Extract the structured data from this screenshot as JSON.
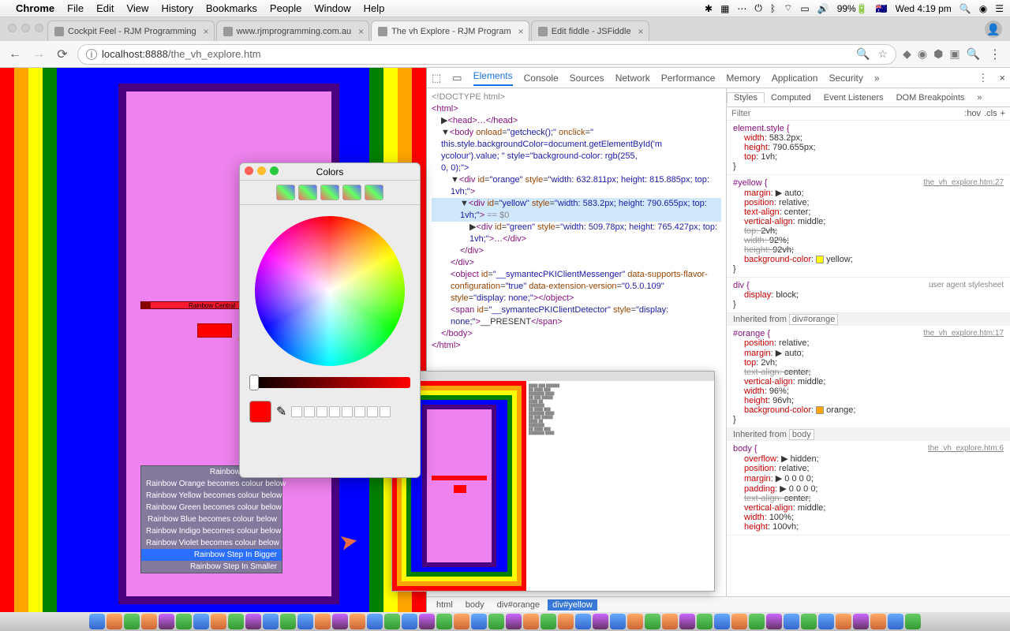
{
  "menubar": {
    "app": "Chrome",
    "items": [
      "File",
      "Edit",
      "View",
      "History",
      "Bookmarks",
      "People",
      "Window",
      "Help"
    ],
    "battery": "99%",
    "clock": "Wed 4:19 pm",
    "flag": "🇦🇺"
  },
  "tabs": [
    {
      "title": "Cockpit Feel - RJM Programming"
    },
    {
      "title": "www.rjmprogramming.com.au"
    },
    {
      "title": "The vh Explore - RJM Program",
      "active": true
    },
    {
      "title": "Edit fiddle - JSFiddle"
    }
  ],
  "omnibox": {
    "host": "localhost:8888",
    "path": "/the_vh_explore.htm"
  },
  "rainbow_label": "Rainbow Central",
  "dropdown": {
    "options": [
      "Rainbow Central",
      "Rainbow Orange becomes colour below",
      "Rainbow Yellow becomes colour below",
      "Rainbow Green becomes colour below",
      "Rainbow Blue becomes colour below",
      "Rainbow Indigo becomes colour below",
      "Rainbow Violet becomes colour below",
      "Rainbow Step In Bigger",
      "Rainbow Step In Smaller"
    ],
    "checked_index": 0,
    "selected_index": 7
  },
  "colorpicker": {
    "title": "Colors"
  },
  "devtools": {
    "tabs": [
      "Elements",
      "Console",
      "Sources",
      "Network",
      "Performance",
      "Memory",
      "Application",
      "Security"
    ],
    "active_tab": "Elements",
    "elements": {
      "doctype": "<!DOCTYPE html>",
      "html_open": "<html>",
      "head": "<head>…</head>",
      "body_open": "<body onload=\"getcheck();\" onclick=\"",
      "body_line2": "this.style.backgroundColor=document.getElementById('m",
      "body_line3": "ycolour').value; \" style=\"background-color: rgb(255,",
      "body_line4": "0, 0);\">",
      "orange": "<div id=\"orange\" style=\"width: 632.811px; height: 815.885px; top: 1vh;\">",
      "yellow": "<div id=\"yellow\" style=\"width: 583.2px; height: 790.655px; top: 1vh;\"> == $0",
      "green": "<div id=\"green\" style=\"width: 509.78px; height: 765.427px; top: 1vh;\">…</div>",
      "div_close": "</div>",
      "object": "<object id=\"__symantecPKIClientMessenger\" data-supports-flavor-configuration=\"true\" data-extension-version=\"0.5.0.109\" style=\"display: none;\"></object>",
      "span": "<span id=\"__symantecPKIClientDetector\" style=\"display: none;\">__PRESENT</span>",
      "body_close": "</body>",
      "html_close": "</html>"
    },
    "styles_tabs": [
      "Styles",
      "Computed",
      "Event Listeners",
      "DOM Breakpoints"
    ],
    "filter_placeholder": "Filter",
    "hov": ":hov",
    "cls": ".cls",
    "rules": {
      "element_style": {
        "selector": "element.style {",
        "props": [
          {
            "n": "width",
            "v": "583.2px;"
          },
          {
            "n": "height",
            "v": "790.655px;"
          },
          {
            "n": "top",
            "v": "1vh;"
          }
        ]
      },
      "yellow": {
        "selector": "#yellow {",
        "src": "the_vh_explore.htm:27",
        "props": [
          {
            "n": "margin",
            "v": "▶ auto;"
          },
          {
            "n": "position",
            "v": "relative;"
          },
          {
            "n": "text-align",
            "v": "center;"
          },
          {
            "n": "vertical-align",
            "v": "middle;"
          },
          {
            "n": "top",
            "v": "2vh;",
            "strike": true
          },
          {
            "n": "width",
            "v": "92%;",
            "strike": true
          },
          {
            "n": "height",
            "v": "92vh;",
            "strike": true
          },
          {
            "n": "background-color",
            "v": "yellow;",
            "swatch": "#ffff00"
          }
        ]
      },
      "div": {
        "selector": "div {",
        "src": "user agent stylesheet",
        "props": [
          {
            "n": "display",
            "v": "block;"
          }
        ]
      },
      "inherit_orange": "Inherited from div#orange",
      "orange": {
        "selector": "#orange {",
        "src": "the_vh_explore.htm:17",
        "props": [
          {
            "n": "position",
            "v": "relative;"
          },
          {
            "n": "margin",
            "v": "▶ auto;"
          },
          {
            "n": "top",
            "v": "2vh;"
          },
          {
            "n": "text-align",
            "v": "center;",
            "strike": true
          },
          {
            "n": "vertical-align",
            "v": "middle;"
          },
          {
            "n": "width",
            "v": "96%;"
          },
          {
            "n": "height",
            "v": "96vh;"
          },
          {
            "n": "background-color",
            "v": "orange;",
            "swatch": "#ffa500"
          }
        ]
      },
      "inherit_body": "Inherited from body",
      "body": {
        "selector": "body {",
        "src": "the_vh_explore.htm:6",
        "props": [
          {
            "n": "overflow",
            "v": "▶ hidden;"
          },
          {
            "n": "position",
            "v": "relative;"
          },
          {
            "n": "margin",
            "v": "▶ 0 0 0 0;"
          },
          {
            "n": "padding",
            "v": "▶ 0 0 0 0;"
          },
          {
            "n": "text-align",
            "v": "center;",
            "strike": true
          },
          {
            "n": "vertical-align",
            "v": "middle;"
          },
          {
            "n": "width",
            "v": "100%;"
          },
          {
            "n": "height",
            "v": "100vh;"
          }
        ]
      }
    },
    "crumbs": [
      "html",
      "body",
      "div#orange",
      "div#yellow"
    ]
  }
}
